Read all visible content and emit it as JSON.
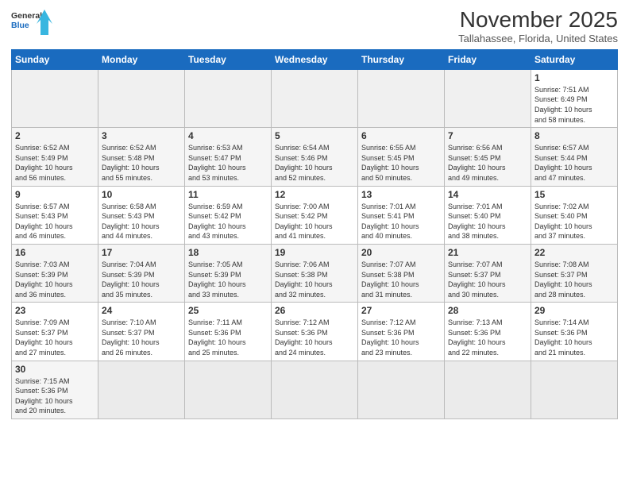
{
  "logo": {
    "line1": "General",
    "line2": "Blue"
  },
  "title": "November 2025",
  "location": "Tallahassee, Florida, United States",
  "weekdays": [
    "Sunday",
    "Monday",
    "Tuesday",
    "Wednesday",
    "Thursday",
    "Friday",
    "Saturday"
  ],
  "weeks": [
    [
      {
        "day": "",
        "empty": true
      },
      {
        "day": "",
        "empty": true
      },
      {
        "day": "",
        "empty": true
      },
      {
        "day": "",
        "empty": true
      },
      {
        "day": "",
        "empty": true
      },
      {
        "day": "",
        "empty": true
      },
      {
        "day": "1",
        "sunrise": "7:51 AM",
        "sunset": "6:49 PM",
        "daylight": "10 hours and 58 minutes."
      }
    ],
    [
      {
        "day": "2",
        "sunrise": "6:52 AM",
        "sunset": "5:49 PM",
        "daylight": "10 hours and 56 minutes."
      },
      {
        "day": "3",
        "sunrise": "6:52 AM",
        "sunset": "5:48 PM",
        "daylight": "10 hours and 55 minutes."
      },
      {
        "day": "4",
        "sunrise": "6:53 AM",
        "sunset": "5:47 PM",
        "daylight": "10 hours and 53 minutes."
      },
      {
        "day": "5",
        "sunrise": "6:54 AM",
        "sunset": "5:46 PM",
        "daylight": "10 hours and 52 minutes."
      },
      {
        "day": "6",
        "sunrise": "6:55 AM",
        "sunset": "5:45 PM",
        "daylight": "10 hours and 50 minutes."
      },
      {
        "day": "7",
        "sunrise": "6:56 AM",
        "sunset": "5:45 PM",
        "daylight": "10 hours and 49 minutes."
      },
      {
        "day": "8",
        "sunrise": "6:57 AM",
        "sunset": "5:44 PM",
        "daylight": "10 hours and 47 minutes."
      }
    ],
    [
      {
        "day": "9",
        "sunrise": "6:57 AM",
        "sunset": "5:43 PM",
        "daylight": "10 hours and 46 minutes."
      },
      {
        "day": "10",
        "sunrise": "6:58 AM",
        "sunset": "5:43 PM",
        "daylight": "10 hours and 44 minutes."
      },
      {
        "day": "11",
        "sunrise": "6:59 AM",
        "sunset": "5:42 PM",
        "daylight": "10 hours and 43 minutes."
      },
      {
        "day": "12",
        "sunrise": "7:00 AM",
        "sunset": "5:42 PM",
        "daylight": "10 hours and 41 minutes."
      },
      {
        "day": "13",
        "sunrise": "7:01 AM",
        "sunset": "5:41 PM",
        "daylight": "10 hours and 40 minutes."
      },
      {
        "day": "14",
        "sunrise": "7:01 AM",
        "sunset": "5:40 PM",
        "daylight": "10 hours and 38 minutes."
      },
      {
        "day": "15",
        "sunrise": "7:02 AM",
        "sunset": "5:40 PM",
        "daylight": "10 hours and 37 minutes."
      }
    ],
    [
      {
        "day": "16",
        "sunrise": "7:03 AM",
        "sunset": "5:39 PM",
        "daylight": "10 hours and 36 minutes."
      },
      {
        "day": "17",
        "sunrise": "7:04 AM",
        "sunset": "5:39 PM",
        "daylight": "10 hours and 35 minutes."
      },
      {
        "day": "18",
        "sunrise": "7:05 AM",
        "sunset": "5:39 PM",
        "daylight": "10 hours and 33 minutes."
      },
      {
        "day": "19",
        "sunrise": "7:06 AM",
        "sunset": "5:38 PM",
        "daylight": "10 hours and 32 minutes."
      },
      {
        "day": "20",
        "sunrise": "7:07 AM",
        "sunset": "5:38 PM",
        "daylight": "10 hours and 31 minutes."
      },
      {
        "day": "21",
        "sunrise": "7:07 AM",
        "sunset": "5:37 PM",
        "daylight": "10 hours and 30 minutes."
      },
      {
        "day": "22",
        "sunrise": "7:08 AM",
        "sunset": "5:37 PM",
        "daylight": "10 hours and 28 minutes."
      }
    ],
    [
      {
        "day": "23",
        "sunrise": "7:09 AM",
        "sunset": "5:37 PM",
        "daylight": "10 hours and 27 minutes."
      },
      {
        "day": "24",
        "sunrise": "7:10 AM",
        "sunset": "5:37 PM",
        "daylight": "10 hours and 26 minutes."
      },
      {
        "day": "25",
        "sunrise": "7:11 AM",
        "sunset": "5:36 PM",
        "daylight": "10 hours and 25 minutes."
      },
      {
        "day": "26",
        "sunrise": "7:12 AM",
        "sunset": "5:36 PM",
        "daylight": "10 hours and 24 minutes."
      },
      {
        "day": "27",
        "sunrise": "7:12 AM",
        "sunset": "5:36 PM",
        "daylight": "10 hours and 23 minutes."
      },
      {
        "day": "28",
        "sunrise": "7:13 AM",
        "sunset": "5:36 PM",
        "daylight": "10 hours and 22 minutes."
      },
      {
        "day": "29",
        "sunrise": "7:14 AM",
        "sunset": "5:36 PM",
        "daylight": "10 hours and 21 minutes."
      }
    ],
    [
      {
        "day": "30",
        "sunrise": "7:15 AM",
        "sunset": "5:36 PM",
        "daylight": "10 hours and 20 minutes."
      },
      {
        "day": "",
        "empty": true
      },
      {
        "day": "",
        "empty": true
      },
      {
        "day": "",
        "empty": true
      },
      {
        "day": "",
        "empty": true
      },
      {
        "day": "",
        "empty": true
      },
      {
        "day": "",
        "empty": true
      }
    ]
  ],
  "labels": {
    "sunrise": "Sunrise:",
    "sunset": "Sunset:",
    "daylight": "Daylight:"
  }
}
